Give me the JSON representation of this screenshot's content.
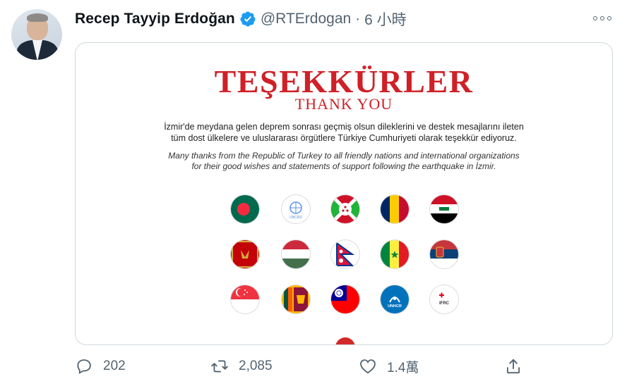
{
  "tweet": {
    "name": "Recep Tayyip Erdoğan",
    "handle": "@RTErdogan",
    "separator": "·",
    "time": "6 小時"
  },
  "image": {
    "title": "TEŞEKKÜRLER",
    "subtitle": "THANK YOU",
    "turkish_line1": "İzmir'de meydana gelen deprem sonrası geçmiş olsun dileklerini ve destek mesajlarını ileten",
    "turkish_line2": "tüm dost ülkelere ve uluslararası örgütlere Türkiye Cumhuriyeti olarak teşekkür ediyoruz.",
    "english_line1": "Many thanks from the Republic of Turkey to all friendly nations and international organizations",
    "english_line2": "for their good wishes and statements of support following the earthquake in İzmir.",
    "flags": [
      "bangladesh",
      "un",
      "burundi",
      "chad",
      "iraq",
      "montenegro",
      "hungary",
      "nepal",
      "senegal",
      "serbia",
      "singapore",
      "sri-lanka",
      "taiwan",
      "unhcr",
      "ifrc"
    ],
    "flag_texts": {
      "un": "UNCRD",
      "unhcr": "UNHCR",
      "ifrc": "IFRC"
    }
  },
  "actions": {
    "reply_count": "202",
    "retweet_count": "2,085",
    "like_count": "1.4萬"
  },
  "colors": {
    "accent_red": "#cf2127",
    "verified_blue": "#1d9bf0",
    "muted": "#536471"
  }
}
